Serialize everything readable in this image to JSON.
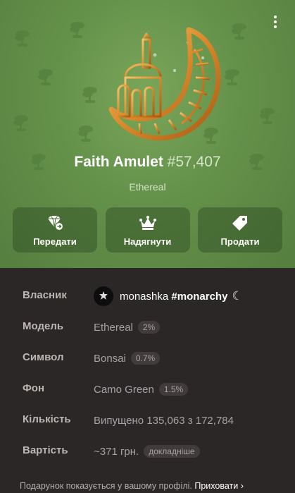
{
  "gift": {
    "name": "Faith Amulet",
    "number": "#57,407",
    "model_tag": "Ethereal"
  },
  "actions": [
    {
      "label": "Передати",
      "icon": "gem-transfer-icon"
    },
    {
      "label": "Надягнути",
      "icon": "crown-icon"
    },
    {
      "label": "Продати",
      "icon": "price-tag-icon"
    }
  ],
  "info": {
    "owner": {
      "key": "Власник",
      "name": "monashka",
      "tag": "#monarchy",
      "emoji": "☾"
    },
    "model": {
      "key": "Модель",
      "value": "Ethereal",
      "badge": "2%"
    },
    "symbol": {
      "key": "Символ",
      "value": "Bonsai",
      "badge": "0.7%"
    },
    "background": {
      "key": "Фон",
      "value": "Camo Green",
      "badge": "1.5%"
    },
    "quantity": {
      "key": "Кількість",
      "value": "Випущено 135,063 з 172,784"
    },
    "price": {
      "key": "Вартість",
      "value": "~371 грн.",
      "badge": "докладніше"
    }
  },
  "footer": {
    "text": "Подарунок показується у вашому профілі.",
    "hide_label": "Приховати"
  },
  "colors": {
    "hero_green": "#64914a",
    "gold": "#d9892a",
    "panel_bg": "#2a2726"
  }
}
